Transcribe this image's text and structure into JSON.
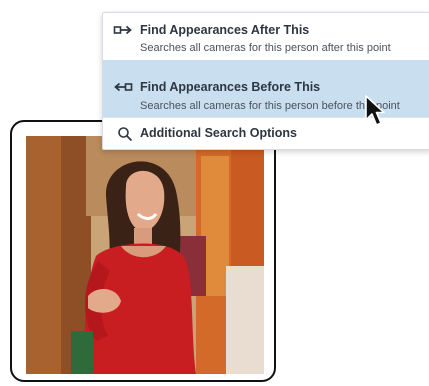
{
  "menu": {
    "items": [
      {
        "icon": "arrow-right-from-box-icon",
        "title": "Find Appearances After This",
        "subtitle": "Searches all cameras for this person after this point"
      },
      {
        "icon": "arrow-left-into-box-icon",
        "title": "Find Appearances Before This",
        "subtitle": "Searches all cameras for this person before this point",
        "highlighted": true
      },
      {
        "icon": "search-icon",
        "title": "Additional Search Options"
      }
    ],
    "highlight_color": "#c9dff0"
  },
  "photo": {
    "subject": "person-thumbnail"
  }
}
